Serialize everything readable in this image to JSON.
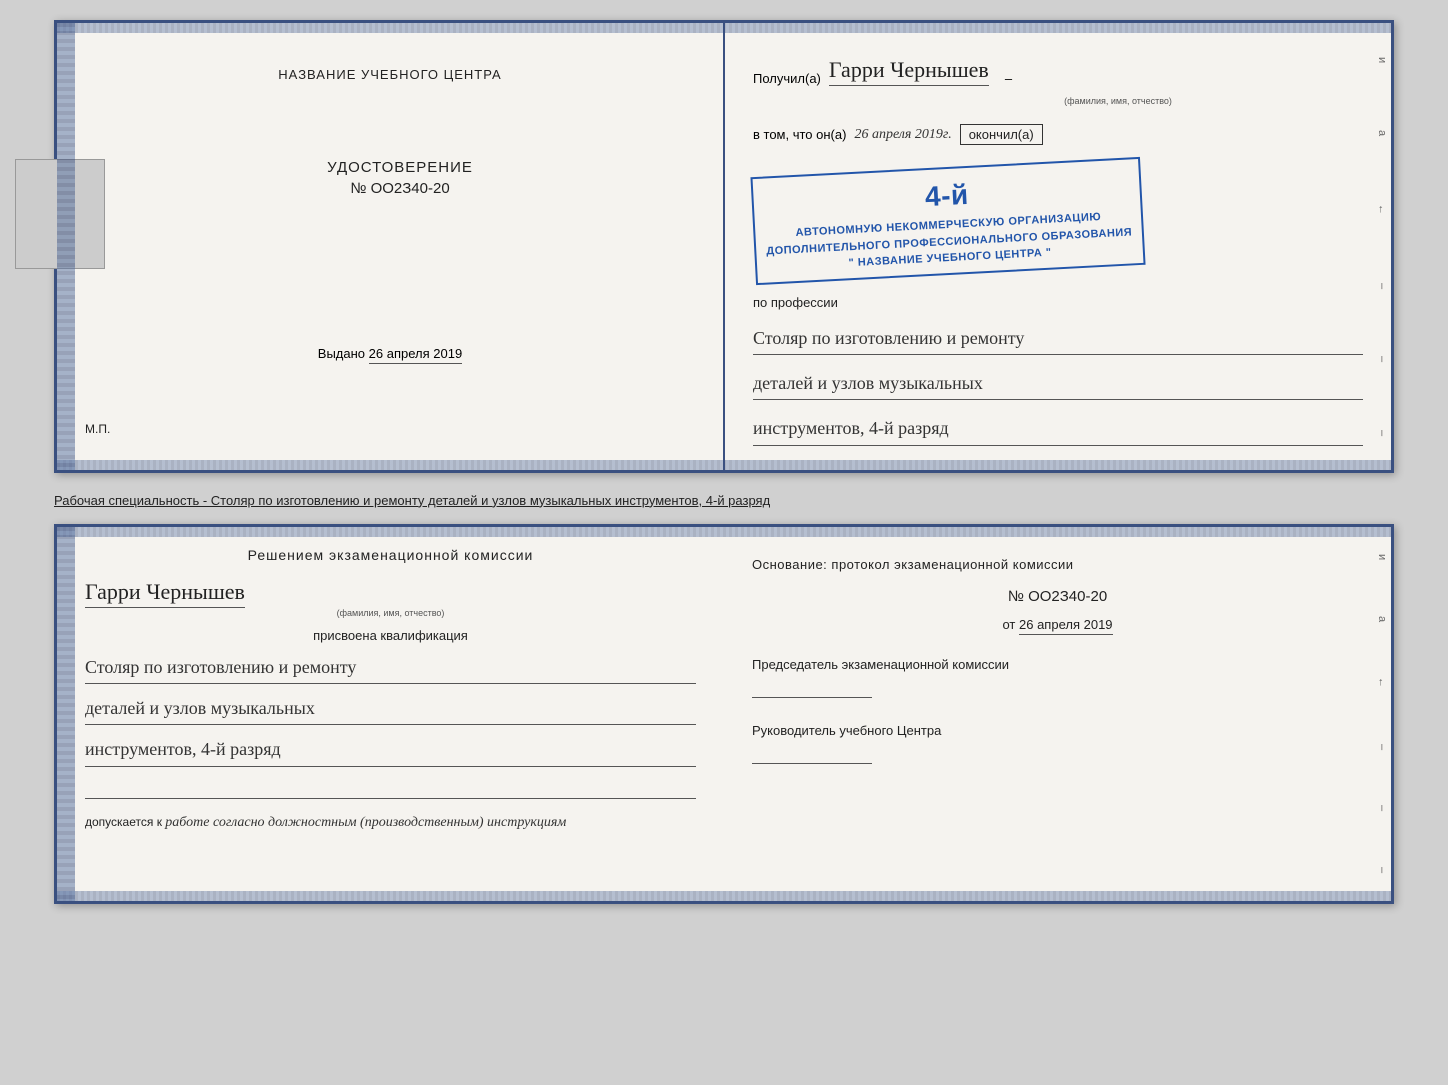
{
  "top_doc": {
    "left": {
      "heading": "НАЗВАНИЕ УЧЕБНОГО ЦЕНТРА",
      "title": "УДОСТОВЕРЕНИЕ",
      "number": "№ OO2З40-20",
      "vydano_label": "Выдано",
      "vydano_date": "26 апреля 2019",
      "mp": "М.П."
    },
    "right": {
      "poluchil_label": "Получил(а)",
      "name_handwritten": "Гарри Чернышев",
      "name_sublabel": "(фамилия, имя, отчество)",
      "dash": "–",
      "vtom_label": "в том, что он(а)",
      "date_handwritten": "26 апреля 2019г.",
      "okoncil_label": "окончил(а)",
      "stamp_number": "4-й",
      "stamp_line1": "АВТОНОМНУЮ НЕКОММЕРЧЕСКУЮ ОРГАНИЗАЦИЮ",
      "stamp_line2": "ДОПОЛНИТЕЛЬНОГО ПРОФЕССИОНАЛЬНОГО ОБРАЗОВАНИЯ",
      "stamp_line3": "\" НАЗВАНИЕ УЧЕБНОГО ЦЕНТРА \"",
      "po_professii": "по профессии",
      "profession_line1": "Столяр по изготовлению и ремонту",
      "profession_line2": "деталей и узлов музыкальных",
      "profession_line3": "инструментов, 4-й разряд"
    }
  },
  "between_label": {
    "text": "Рабочая специальность - Столяр по изготовлению и ремонту деталей и узлов музыкальных инструментов, 4-й разряд"
  },
  "bottom_doc": {
    "left": {
      "resheniem": "Решением  экзаменационной  комиссии",
      "name_handwritten": "Гарри Чернышев",
      "name_sublabel": "(фамилия, имя, отчество)",
      "prisvoena": "присвоена квалификация",
      "profession_line1": "Столяр по изготовлению и ремонту",
      "profession_line2": "деталей и узлов музыкальных",
      "profession_line3": "инструментов, 4-й разряд",
      "dopuskaetsya": "допускается к",
      "dopusk_handwritten": "работе согласно должностным (производственным) инструкциям"
    },
    "right": {
      "osnovanie": "Основание: протокол экзаменационной  комиссии",
      "number": "№  OO2З40-20",
      "ot_label": "от",
      "ot_date": "26 апреля 2019",
      "predsedatel_label": "Председатель экзаменационной комиссии",
      "rukovoditel_label": "Руководитель учебного Центра"
    }
  },
  "side_chars": {
    "top": [
      "и",
      "а",
      "←",
      "–",
      "–",
      "–",
      "–"
    ],
    "bottom": [
      "и",
      "а",
      "←",
      "–",
      "–",
      "–",
      "–"
    ]
  }
}
